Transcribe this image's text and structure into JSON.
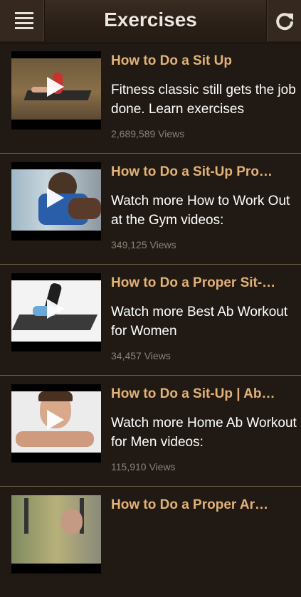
{
  "header": {
    "title": "Exercises",
    "menu_icon": "menu-icon",
    "refresh_icon": "refresh-icon"
  },
  "items": [
    {
      "title": "How to Do a Sit Up",
      "description": "Fitness classic still gets the job done. Learn exercises",
      "views": "2,689,589 Views"
    },
    {
      "title": "How to Do a Sit-Up Pro…",
      "description": "Watch more How to Work Out at the Gym videos:",
      "views": "349,125 Views"
    },
    {
      "title": "How to Do a Proper Sit-…",
      "description": "Watch more Best Ab Workout for Women",
      "views": "34,457 Views"
    },
    {
      "title": "How to Do a Sit-Up | Ab…",
      "description": "Watch more Home Ab Workout for Men videos:",
      "views": "115,910 Views"
    },
    {
      "title": "How to Do a Proper Ar…",
      "description": "",
      "views": ""
    }
  ]
}
